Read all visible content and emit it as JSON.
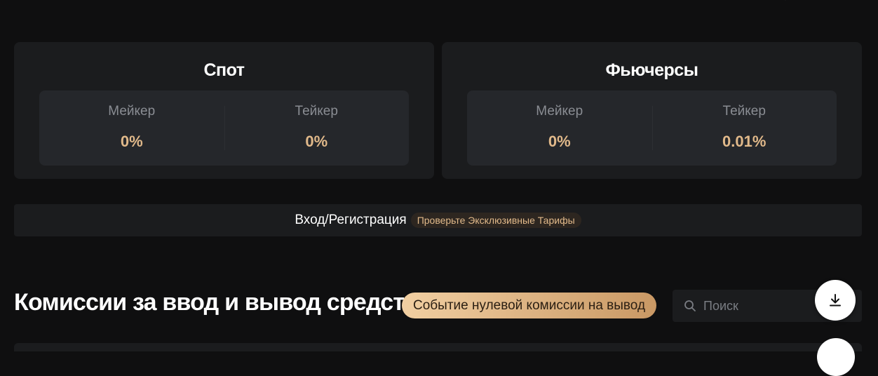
{
  "spot": {
    "title": "Спот",
    "maker_label": "Мейкер",
    "maker_value": "0%",
    "taker_label": "Тейкер",
    "taker_value": "0%"
  },
  "futures": {
    "title": "Фьючерсы",
    "maker_label": "Мейкер",
    "maker_value": "0%",
    "taker_label": "Тейкер",
    "taker_value": "0.01%"
  },
  "login_bar": {
    "link": "Вход/Регистрация",
    "badge": "Проверьте Эксклюзивные Тарифы"
  },
  "deposit_section": {
    "title": "Комиссии за ввод и вывод средств",
    "event_button": "Событие нулевой комиссии на вывод",
    "search_placeholder": "Поиск"
  },
  "icons": {
    "search": "search-icon",
    "download": "download-icon"
  },
  "colors": {
    "background": "#0f0f10",
    "card": "#1b1c1e",
    "inner_card": "#25272b",
    "accent_gold": "#e1b98a",
    "label_gray": "#8a8d93"
  }
}
